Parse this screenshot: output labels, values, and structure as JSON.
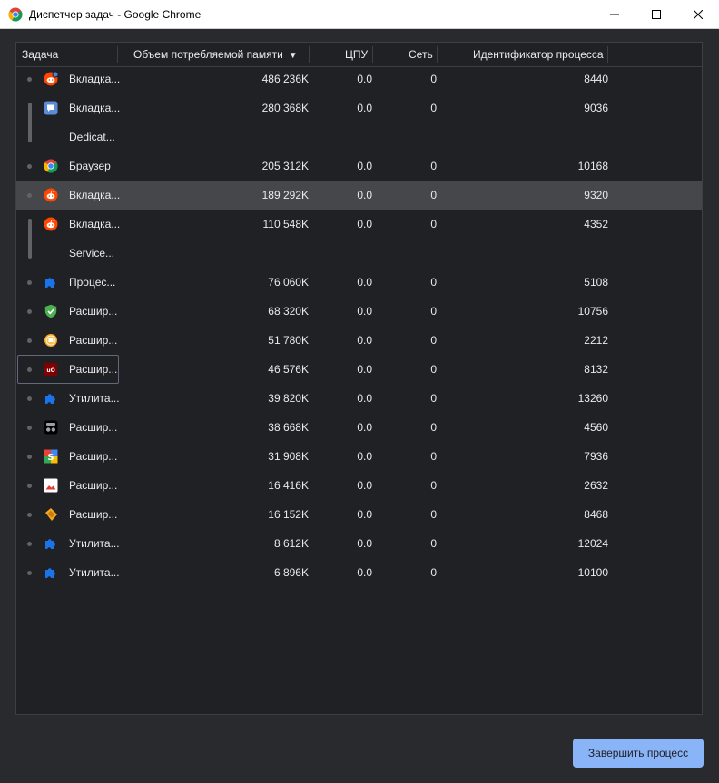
{
  "window": {
    "title": "Диспетчер задач - Google Chrome",
    "app_icon": "chrome-icon"
  },
  "table": {
    "columns": {
      "task": "Задача",
      "memory": "Объем потребляемой памяти",
      "cpu": "ЦПУ",
      "network": "Сеть",
      "pid": "Идентификатор процесса"
    },
    "sort_indicator": "▼",
    "rows": [
      {
        "task": "Вкладка...",
        "memory": "486 236K",
        "cpu": "0.0",
        "network": "0",
        "pid": "8440",
        "icon": "reddit-notification-icon"
      },
      {
        "task": "Вкладка...",
        "memory": "280 368K",
        "cpu": "0.0",
        "network": "0",
        "pid": "9036",
        "icon": "chat-icon"
      },
      {
        "task": "Dedicat...",
        "memory": "",
        "cpu": "",
        "network": "",
        "pid": "",
        "icon": ""
      },
      {
        "task": "Браузер",
        "memory": "205 312K",
        "cpu": "0.0",
        "network": "0",
        "pid": "10168",
        "icon": "chrome-icon"
      },
      {
        "task": "Вкладка...",
        "memory": "189 292K",
        "cpu": "0.0",
        "network": "0",
        "pid": "9320",
        "icon": "reddit-icon"
      },
      {
        "task": "Вкладка...",
        "memory": "110 548K",
        "cpu": "0.0",
        "network": "0",
        "pid": "4352",
        "icon": "reddit-icon"
      },
      {
        "task": "Service...",
        "memory": "",
        "cpu": "",
        "network": "",
        "pid": "",
        "icon": ""
      },
      {
        "task": "Процес...",
        "memory": "76 060K",
        "cpu": "0.0",
        "network": "0",
        "pid": "5108",
        "icon": "puzzle-icon"
      },
      {
        "task": "Расшир...",
        "memory": "68 320K",
        "cpu": "0.0",
        "network": "0",
        "pid": "10756",
        "icon": "shield-check-icon"
      },
      {
        "task": "Расшир...",
        "memory": "51 780K",
        "cpu": "0.0",
        "network": "0",
        "pid": "2212",
        "icon": "coin-icon"
      },
      {
        "task": "Расшир...",
        "memory": "46 576K",
        "cpu": "0.0",
        "network": "0",
        "pid": "8132",
        "icon": "ublock-icon"
      },
      {
        "task": "Утилита...",
        "memory": "39 820K",
        "cpu": "0.0",
        "network": "0",
        "pid": "13260",
        "icon": "puzzle-icon"
      },
      {
        "task": "Расшир...",
        "memory": "38 668K",
        "cpu": "0.0",
        "network": "0",
        "pid": "4560",
        "icon": "incognito-icon"
      },
      {
        "task": "Расшир...",
        "memory": "31 908K",
        "cpu": "0.0",
        "network": "0",
        "pid": "7936",
        "icon": "s-logo-icon"
      },
      {
        "task": "Расшир...",
        "memory": "16 416K",
        "cpu": "0.0",
        "network": "0",
        "pid": "2632",
        "icon": "image-icon"
      },
      {
        "task": "Расшир...",
        "memory": "16 152K",
        "cpu": "0.0",
        "network": "0",
        "pid": "8468",
        "icon": "tag-icon"
      },
      {
        "task": "Утилита...",
        "memory": "8 612K",
        "cpu": "0.0",
        "network": "0",
        "pid": "12024",
        "icon": "puzzle-icon"
      },
      {
        "task": "Утилита...",
        "memory": "6 896K",
        "cpu": "0.0",
        "network": "0",
        "pid": "10100",
        "icon": "puzzle-icon"
      }
    ]
  },
  "footer": {
    "end_process_label": "Завершить процесс"
  },
  "colors": {
    "background": "#292a2d",
    "panel": "#202124",
    "selected_row": "#45474a",
    "accent_button": "#8ab4f8",
    "reddit": "#ff4500",
    "puzzle": "#1a73e8"
  }
}
